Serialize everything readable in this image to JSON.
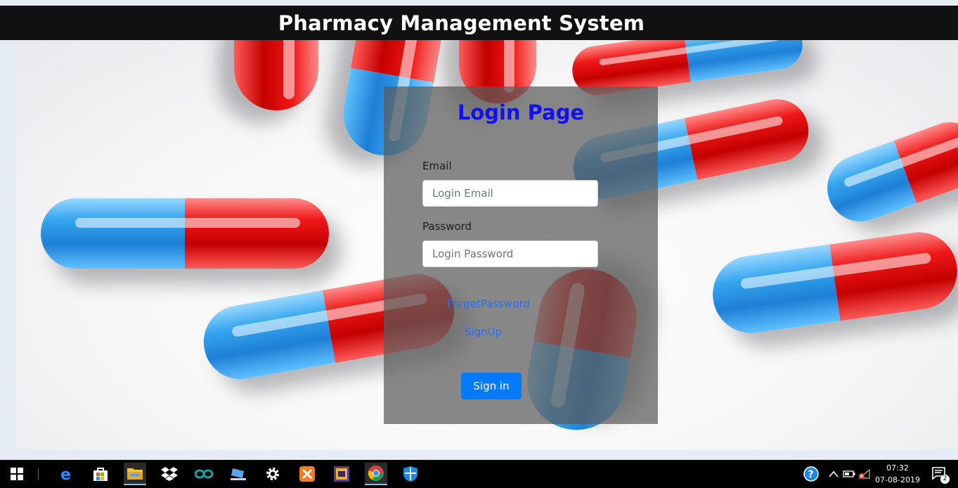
{
  "header": {
    "title": "Pharmacy Management System"
  },
  "login": {
    "title": "Login Page",
    "email_label": "Email",
    "email_placeholder": "Login Email",
    "email_value": "",
    "password_label": "Password",
    "password_placeholder": "Login Password",
    "password_value": "",
    "forget_password_link": "ForgetPassword",
    "signup_link": "SignUp",
    "signin_button": "Sign in"
  },
  "colors": {
    "header_bg": "#111111",
    "title_color": "#1010f0",
    "link_color": "#2a6df0",
    "button_bg": "#007bff"
  },
  "taskbar": {
    "icons": [
      "windows-start-icon",
      "edge-icon",
      "store-icon",
      "file-explorer-icon",
      "dropbox-icon",
      "arduino-icon",
      "laptop-app-icon",
      "settings-gear-icon",
      "xampp-icon",
      "app-icon",
      "chrome-icon",
      "defender-shield-icon"
    ],
    "clock_time": "07:32",
    "clock_date": "07-08-2019",
    "notification_count": "2"
  }
}
